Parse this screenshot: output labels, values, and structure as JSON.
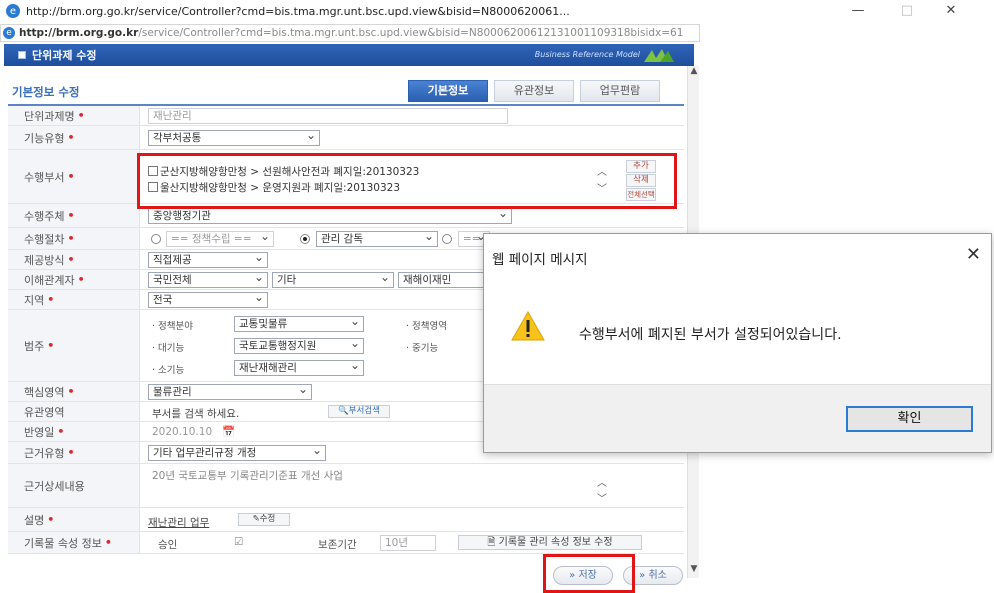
{
  "window": {
    "title": "http://brm.org.go.kr/service/Controller?cmd=bis.tma.mgr.unt.bsc.upd.view&bisid=N8000620061...",
    "url_host": "http://brm.org.go.kr",
    "url_rest": "/service/Controller?cmd=bis.tma.mgr.unt.bsc.upd.view&bisid=N80006200612131001109318bisidx=61",
    "minimize": "—",
    "maximize": "□",
    "close": "✕"
  },
  "header": {
    "title": "단위과제 수정",
    "brand": "Business Reference Model"
  },
  "section_title": "기본정보 수정",
  "tabs": [
    {
      "label": "기본정보",
      "active": true
    },
    {
      "label": "유관정보",
      "active": false
    },
    {
      "label": "업무편람",
      "active": false
    }
  ],
  "fields": {
    "task_name": {
      "label": "단위과제명",
      "value": "재난관리"
    },
    "func_type": {
      "label": "기능유형",
      "value": "각부처공통"
    },
    "dept": {
      "label": "수행부서",
      "items": [
        "군산지방해양항만청 > 선원해사안전과 폐지일:20130323",
        "울산지방해양항만청 > 운영지원과 폐지일:20130323"
      ],
      "btn_add": "추가",
      "btn_delete": "삭제",
      "btn_select_all": "전체선택"
    },
    "actor": {
      "label": "수행주체",
      "value": "중앙행정기관"
    },
    "procedure": {
      "label": "수행절차",
      "opt1": "== 정책수립 ==",
      "opt2": "관리 감독",
      "opt3": "== 정책평가 =="
    },
    "offer_method": {
      "label": "제공방식",
      "value": "직접제공"
    },
    "stakeholder": {
      "label": "이해관계자",
      "value1": "국민전체",
      "value2": "기타",
      "value3": "재해이재민"
    },
    "region": {
      "label": "지역",
      "value": "전국"
    },
    "category": {
      "label": "범주",
      "policy_field_label": "· 정책분야",
      "policy_field": "교통및물류",
      "policy_area_label": "· 정책영역",
      "large_func_label": "· 대기능",
      "large_func": "국토교통행정지원",
      "mid_func_label": "· 중기능",
      "small_func_label": "· 소기능",
      "small_func": "재난재해관리"
    },
    "core_area": {
      "label": "핵심영역",
      "value": "물류관리"
    },
    "related_area": {
      "label": "유관영역",
      "placeholder": "부서를 검색 하세요.",
      "btn": "부서검색"
    },
    "reflect_date": {
      "label": "반영일",
      "value": "2020.10.10"
    },
    "basis_type": {
      "label": "근거유형",
      "value": "기타 업무관리규정 개정"
    },
    "basis_detail": {
      "label": "근거상세내용",
      "value": "20년 국토교통부 기록관리기준표 개선 사업"
    },
    "description": {
      "label": "설명",
      "value": "재난관리 업무",
      "btn": "수정"
    },
    "record_attr": {
      "label": "기록물 속성 정보",
      "approval": "승인",
      "retention_label": "보존기간",
      "retention": "10년",
      "btn": "기록물 관리 속성 정보 수정"
    }
  },
  "buttons": {
    "save": "» 저장",
    "cancel": "» 취소"
  },
  "dialog": {
    "title": "웹 페이지 메시지",
    "message": "수행부서에 폐지된 부서가 설정되어있습니다.",
    "ok": "확인",
    "close": "✕"
  },
  "colors": {
    "header_blue": "#2f65b8",
    "highlight_red": "#e01616",
    "required_red": "#e0262a",
    "ok_border": "#2a7bd1"
  }
}
